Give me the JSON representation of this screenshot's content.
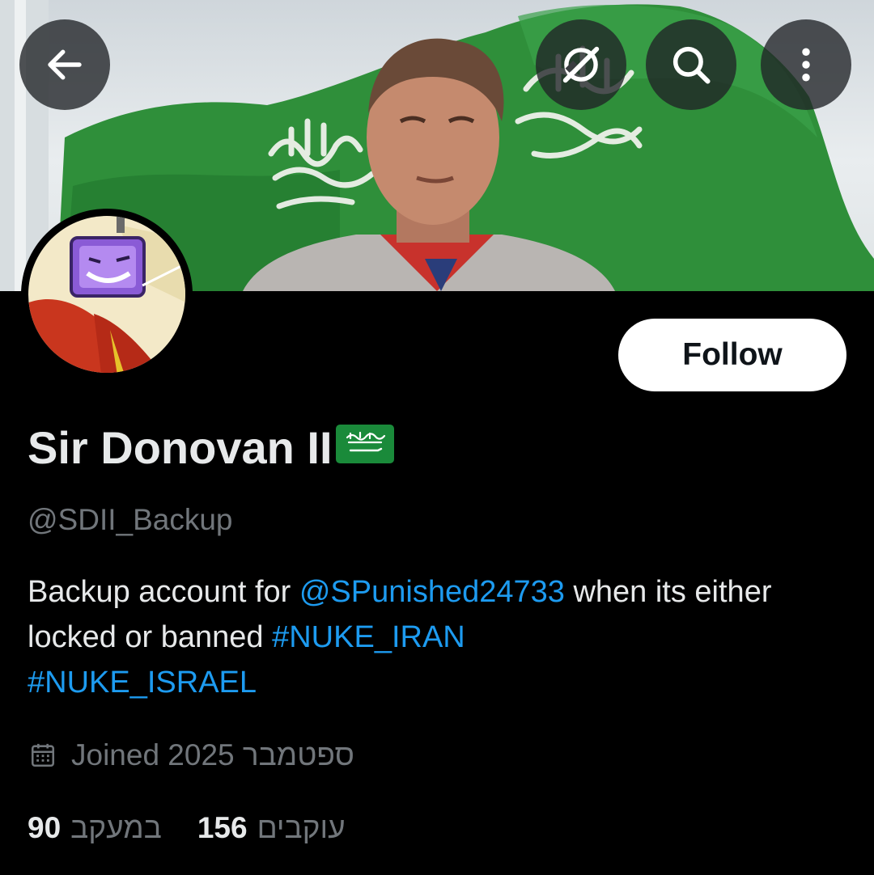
{
  "profile": {
    "display_name": "Sir Donovan II",
    "name_flag_icon": "saudi-flag-emoji",
    "handle": "@SDII_Backup",
    "follow_label": "Follow",
    "bio": {
      "part1": "Backup account for ",
      "mention": "@SPunished24733",
      "part2": " when its either locked or banned  ",
      "hashtag1": "#NUKE_IRAN",
      "hashtag2": "#NUKE_ISRAEL"
    },
    "joined": "Joined 2025 ספטמבר",
    "stats": [
      {
        "number": "90",
        "label": "במעקב"
      },
      {
        "number": "156",
        "label": "עוקבים"
      }
    ]
  },
  "header_buttons": [
    "back-arrow-icon",
    "grok-icon",
    "search-icon",
    "more-vertical-icon"
  ],
  "colors": {
    "background": "#000000",
    "primary_text": "#e7e9ea",
    "secondary_text": "#71767b",
    "link": "#1d9bf0",
    "follow_bg": "#ffffff",
    "banner_flag": "#2f8f3a"
  }
}
